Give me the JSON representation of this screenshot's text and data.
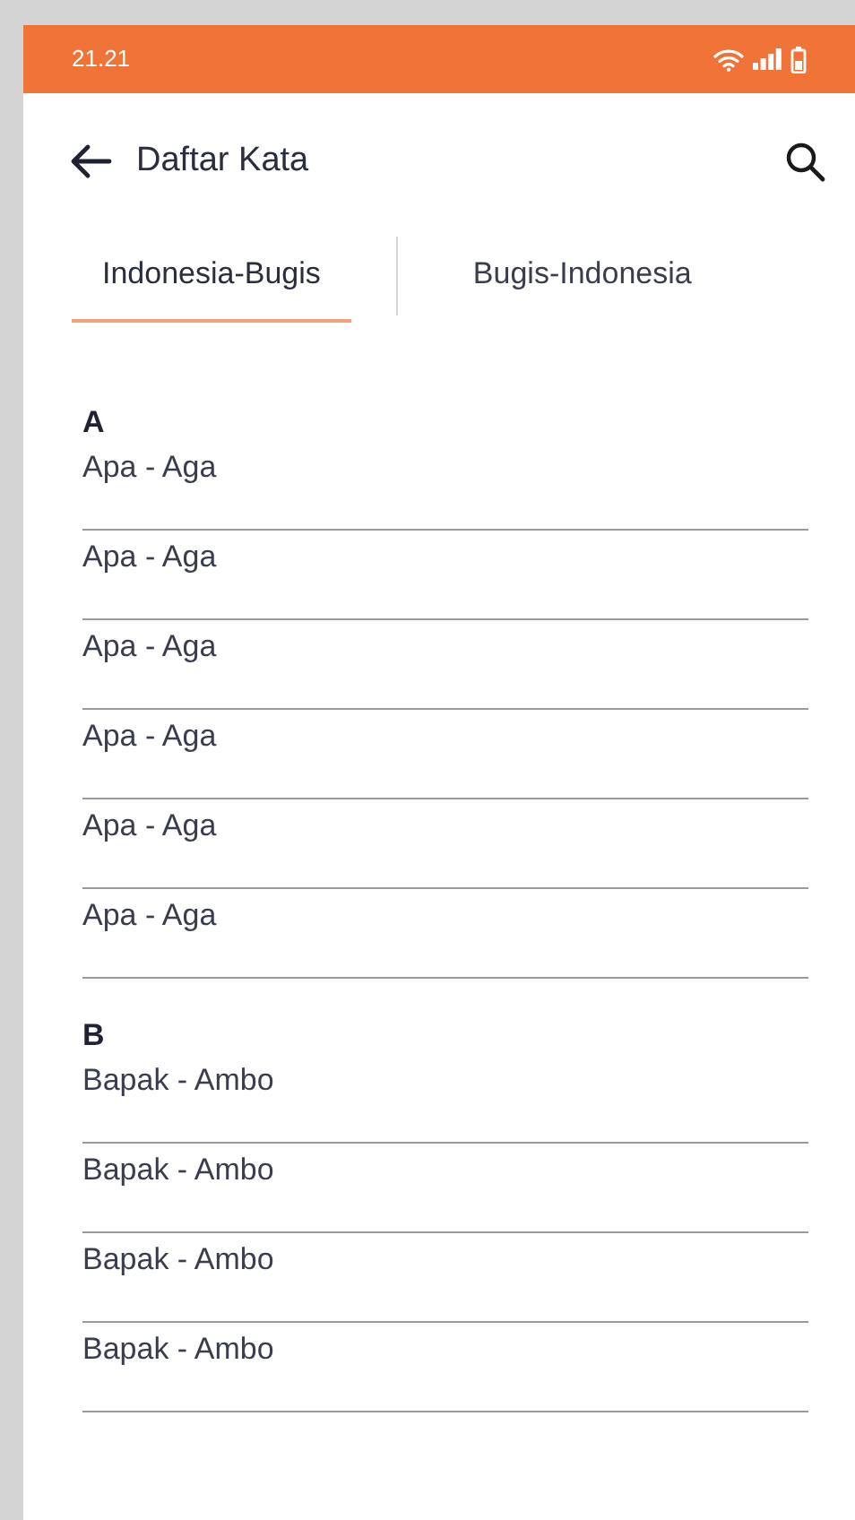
{
  "status_bar": {
    "time": "21.21"
  },
  "header": {
    "title": "Daftar Kata"
  },
  "tabs": [
    {
      "label": "Indonesia-Bugis",
      "selected": true
    },
    {
      "label": "Bugis-Indonesia",
      "selected": false
    }
  ],
  "sections": [
    {
      "letter": "A",
      "entries": [
        "Apa - Aga",
        "Apa - Aga",
        "Apa - Aga",
        "Apa - Aga",
        "Apa - Aga",
        "Apa - Aga"
      ]
    },
    {
      "letter": "B",
      "entries": [
        "Bapak - Ambo",
        "Bapak - Ambo",
        "Bapak - Ambo",
        "Bapak - Ambo"
      ]
    }
  ]
}
